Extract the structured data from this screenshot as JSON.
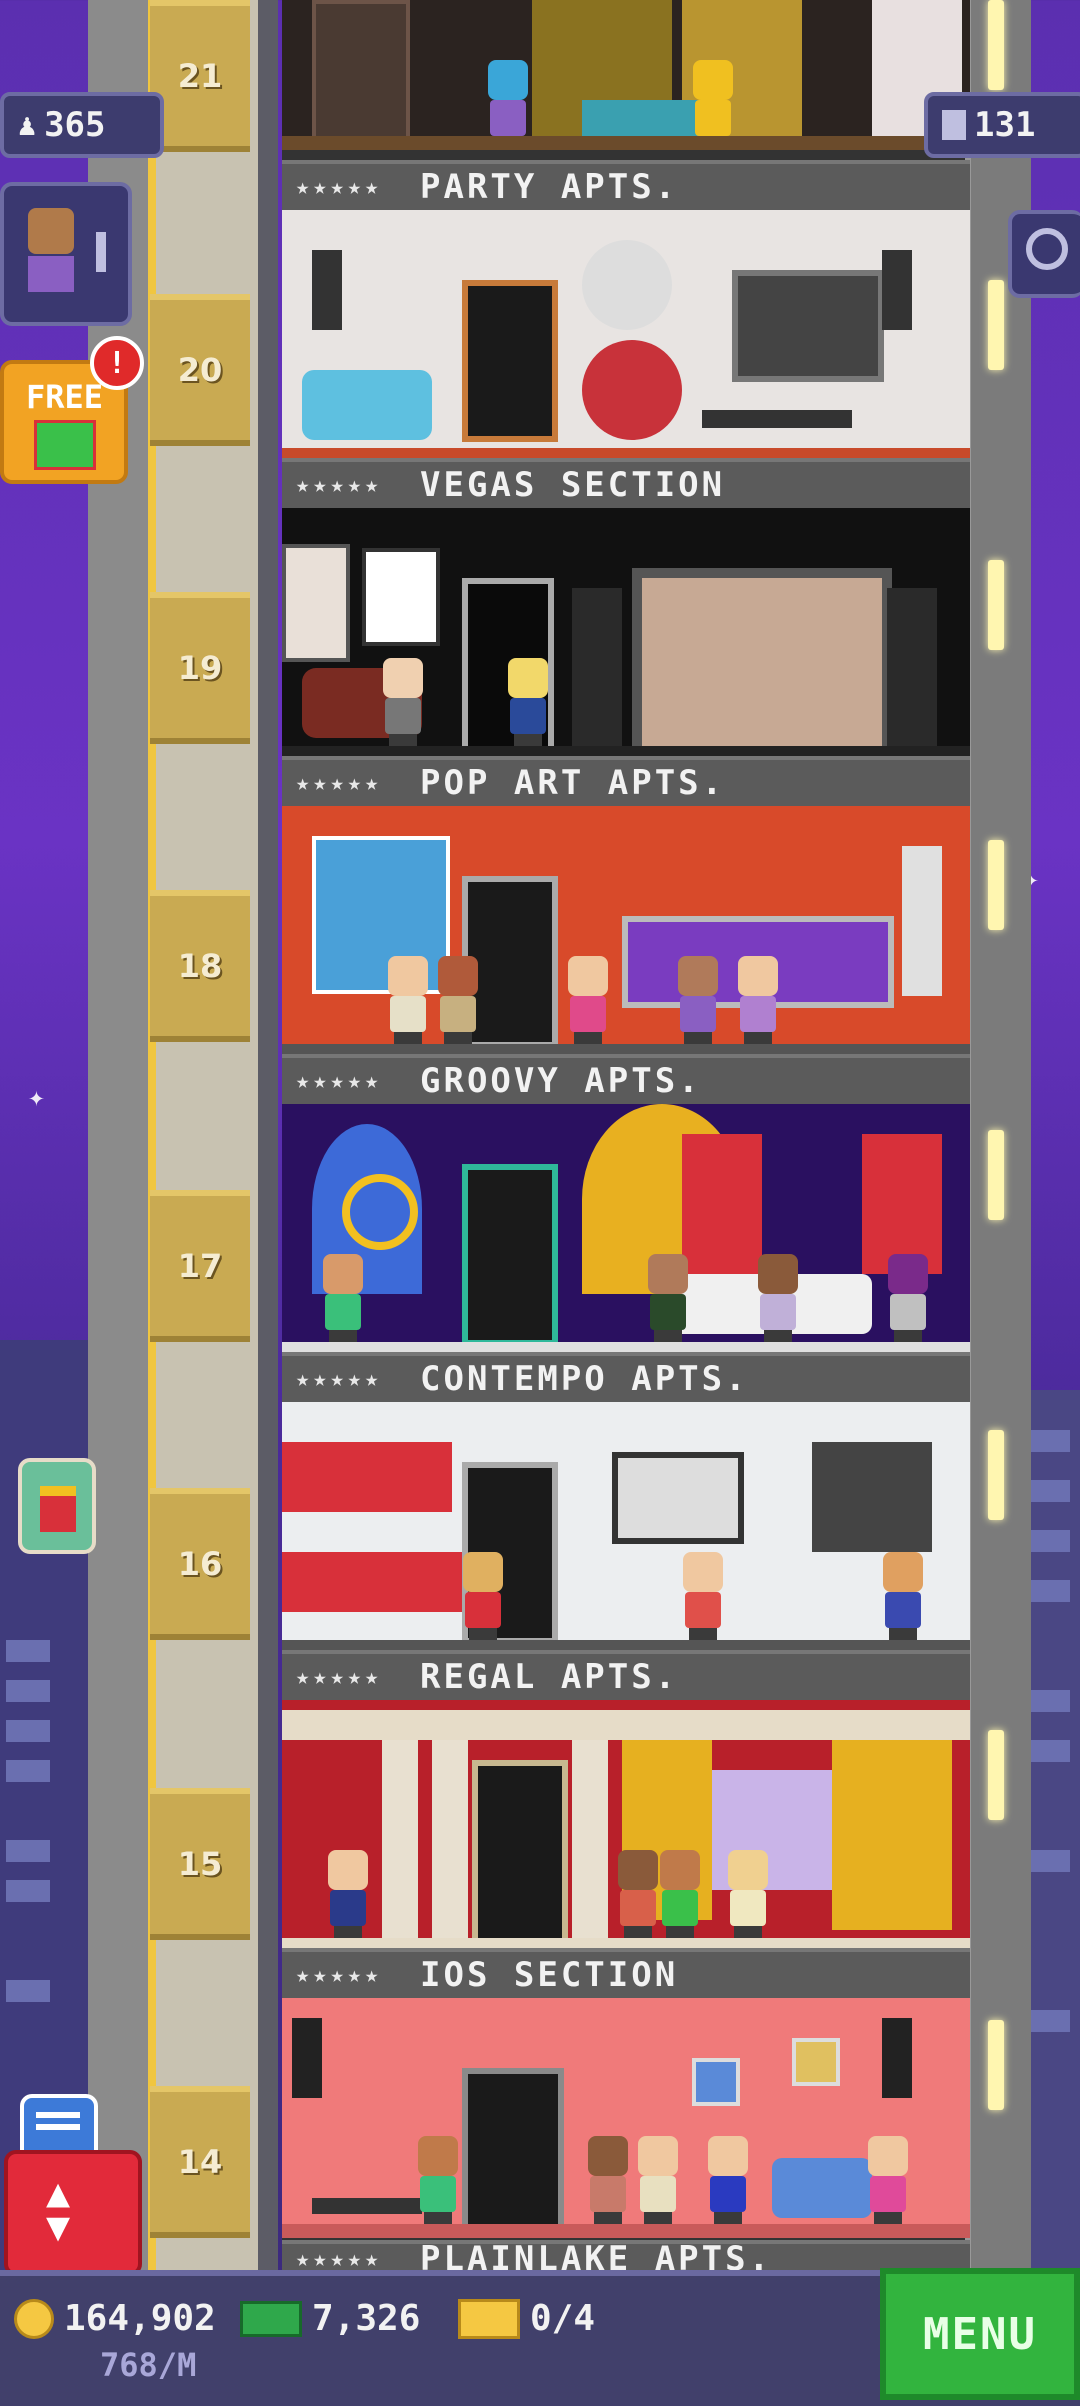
{
  "hud": {
    "population": "365",
    "floors": "131",
    "free_label": "FREE",
    "free_alert": "!"
  },
  "bottom": {
    "coins": "164,902",
    "bux": "7,326",
    "tickets": "0/4",
    "rate": "768/M",
    "menu_label": "MENU"
  },
  "floors": [
    {
      "number": "21",
      "label": "PARTY APTS.",
      "stars": "★★★★★"
    },
    {
      "number": "20",
      "label": "VEGAS SECTION",
      "stars": "★★★★★"
    },
    {
      "number": "19",
      "label": "POP ART APTS.",
      "stars": "★★★★★"
    },
    {
      "number": "18",
      "label": "GROOVY APTS.",
      "stars": "★★★★★"
    },
    {
      "number": "17",
      "label": "CONTEMPO APTS.",
      "stars": "★★★★★"
    },
    {
      "number": "16",
      "label": "REGAL APTS.",
      "stars": "★★★★★"
    },
    {
      "number": "15",
      "label": "IOS SECTION",
      "stars": "★★★★★"
    },
    {
      "number": "14",
      "label": "PLAINLAKE APTS.",
      "stars": "★★★★★"
    }
  ],
  "icons": {
    "population": "person-icon",
    "floors": "building-icon",
    "search": "magnifier-icon",
    "gift": "gift-icon",
    "elevator": "up-down-arrows-icon",
    "chat": "chat-icon",
    "coin": "coin-icon",
    "bux": "bux-icon",
    "ticket": "ticket-icon"
  },
  "colors": {
    "sky": "#5b2fb0",
    "menu": "#32b43e",
    "elevator_button": "#e22a3a",
    "free_button": "#f2a323"
  }
}
